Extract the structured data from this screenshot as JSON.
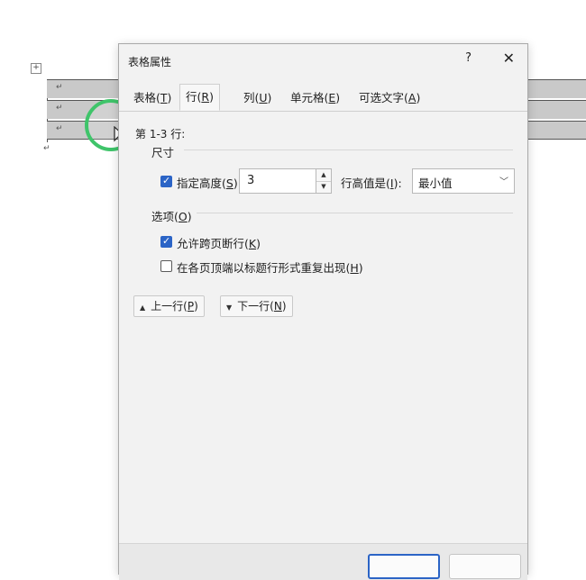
{
  "dialog": {
    "title": "表格属性",
    "help_label": "?",
    "close_label": "✕"
  },
  "tabs": [
    {
      "label": "表格(",
      "key": "T",
      "suffix": ")"
    },
    {
      "label": "行(",
      "key": "R",
      "suffix": ")"
    },
    {
      "label": "列(",
      "key": "U",
      "suffix": ")"
    },
    {
      "label": "单元格(",
      "key": "E",
      "suffix": ")"
    },
    {
      "label": "可选文字(",
      "key": "A",
      "suffix": ")"
    }
  ],
  "active_tab": "行(R)",
  "row_panel": {
    "rows_label": "第 1-3 行:",
    "size_heading": "尺寸",
    "specify_height": {
      "label": "指定高度(",
      "key": "S",
      "suffix": "):",
      "checked": true
    },
    "height_value": "3",
    "rule_label": "行高值是(",
    "rule_key": "I",
    "rule_suffix": "):",
    "rule_value": "最小值",
    "options_heading": "选项(",
    "options_key": "O",
    "options_suffix": ")",
    "allow_break": {
      "label": "允许跨页断行(",
      "key": "K",
      "suffix": ")",
      "checked": true
    },
    "repeat_header": {
      "label": "在各页顶端以标题行形式重复出现(",
      "key": "H",
      "suffix": ")",
      "checked": false
    },
    "prev_row": {
      "label": "上一行(",
      "key": "P",
      "suffix": ")"
    },
    "next_row": {
      "label": "下一行(",
      "key": "N",
      "suffix": ")"
    }
  },
  "document": {
    "cell_marks": [
      "↵",
      "↵",
      "↵"
    ],
    "end_mark": "↵",
    "move_handle": "+"
  },
  "colors": {
    "accent": "#2b64c6",
    "cursor_highlight": "#3fc46a",
    "table_fill": "#c9c9c9"
  }
}
